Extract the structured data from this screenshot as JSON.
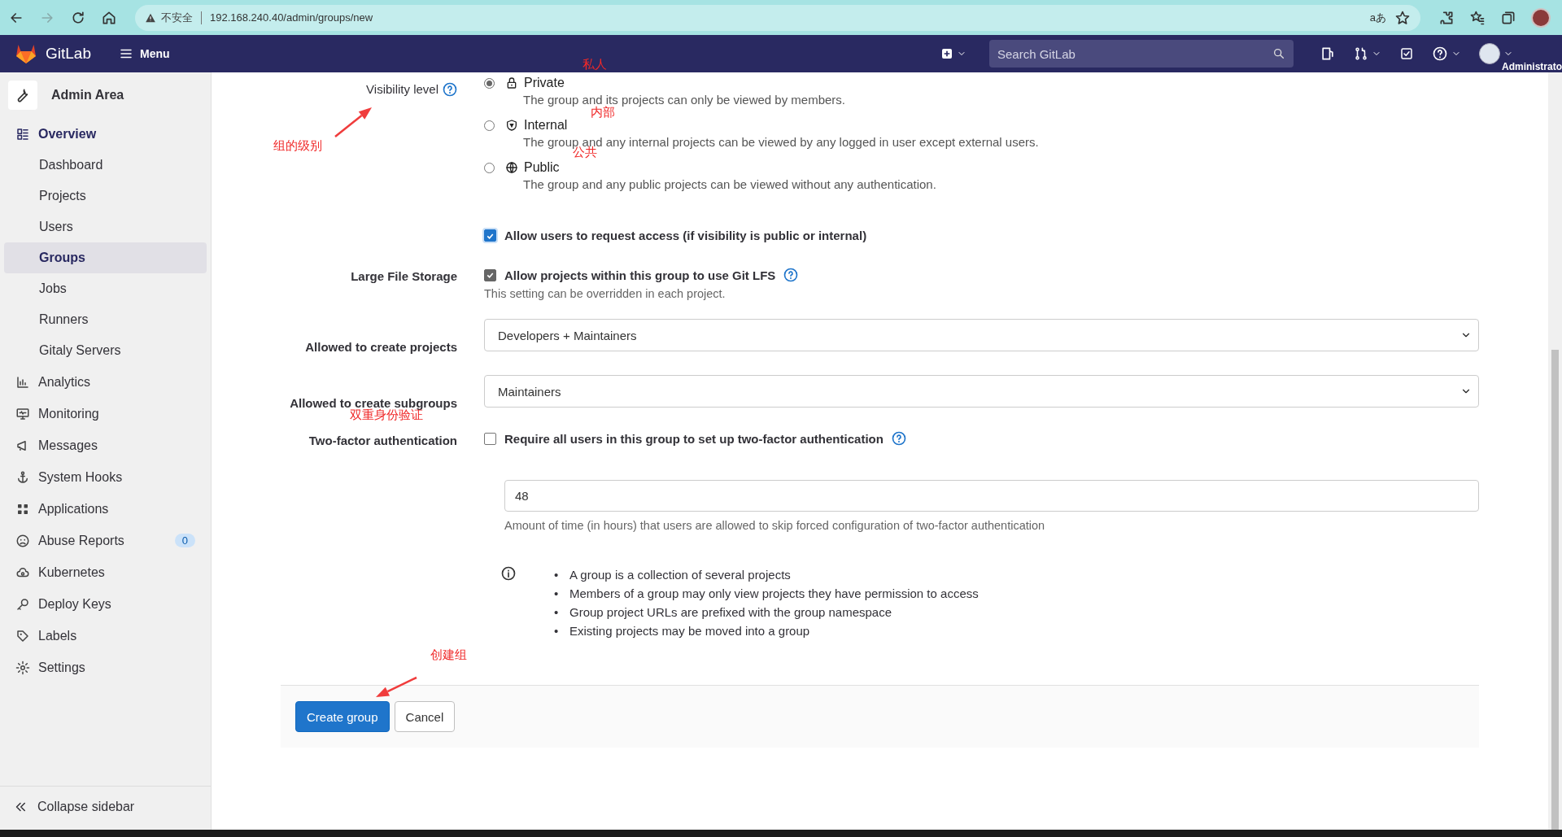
{
  "browser": {
    "security": "不安全",
    "url": "192.168.240.40/admin/groups/new",
    "read_aloud": "aあ"
  },
  "header": {
    "brand": "GitLab",
    "menu": "Menu",
    "search": {
      "placeholder": "Search GitLab"
    },
    "user": "Administrato"
  },
  "sidebar": {
    "title": "Admin Area",
    "items": [
      {
        "label": "Overview",
        "selected": true,
        "children": [
          {
            "label": "Dashboard",
            "selected": false
          },
          {
            "label": "Projects",
            "selected": false
          },
          {
            "label": "Users",
            "selected": false
          },
          {
            "label": "Groups",
            "selected": true
          },
          {
            "label": "Jobs",
            "selected": false
          },
          {
            "label": "Runners",
            "selected": false
          },
          {
            "label": "Gitaly Servers",
            "selected": false
          }
        ]
      },
      {
        "label": "Analytics",
        "selected": false
      },
      {
        "label": "Monitoring",
        "selected": false
      },
      {
        "label": "Messages",
        "selected": false
      },
      {
        "label": "System Hooks",
        "selected": false
      },
      {
        "label": "Applications",
        "selected": false
      },
      {
        "label": "Abuse Reports",
        "selected": false,
        "badge": "0"
      },
      {
        "label": "Kubernetes",
        "selected": false
      },
      {
        "label": "Deploy Keys",
        "selected": false
      },
      {
        "label": "Labels",
        "selected": false
      },
      {
        "label": "Settings",
        "selected": false
      }
    ],
    "collapse": "Collapse sidebar"
  },
  "form": {
    "visibility": {
      "label": "Visibility level",
      "options": [
        {
          "label": "Private",
          "description": "The group and its projects can only be viewed by members.",
          "selected": true
        },
        {
          "label": "Internal",
          "description": "The group and any internal projects can be viewed by any logged in user except external users.",
          "selected": false
        },
        {
          "label": "Public",
          "description": "The group and any public projects can be viewed without any authentication.",
          "selected": false
        }
      ]
    },
    "request_access": {
      "label": "Allow users to request access (if visibility is public or internal)",
      "checked": true,
      "focused": true
    },
    "lfs": {
      "label": "Large File Storage",
      "option": "Allow projects within this group to use Git LFS",
      "checked": true,
      "help": "This setting can be overridden in each project."
    },
    "create_projects": {
      "label": "Allowed to create projects",
      "value": "Developers + Maintainers"
    },
    "create_subgroups": {
      "label": "Allowed to create subgroups",
      "value": "Maintainers"
    },
    "two_factor": {
      "label": "Two-factor authentication",
      "option": "Require all users in this group to set up two-factor authentication",
      "checked": false,
      "grace_period": "48",
      "grace_help": "Amount of time (in hours) that users are allowed to skip forced configuration of two-factor authentication"
    },
    "info": [
      {
        "bullet": "•",
        "text": "A group is a collection of several projects"
      },
      {
        "bullet": "•",
        "text": "Members of a group may only view projects they have permission to access"
      },
      {
        "bullet": "•",
        "text": "Group project URLs are prefixed with the group namespace"
      },
      {
        "bullet": "•",
        "text": "Existing projects may be moved into a group"
      }
    ],
    "buttons": [
      {
        "label": "Create group",
        "kind": "primary"
      },
      {
        "label": "Cancel",
        "kind": "secondary"
      }
    ]
  },
  "annotations": [
    {
      "text": "私人",
      "arrow": false
    },
    {
      "text": "内部",
      "arrow": false
    },
    {
      "text": "公共",
      "arrow": false
    },
    {
      "text": "组的级别",
      "arrow": true
    },
    {
      "text": "双重身份验证",
      "arrow": false
    },
    {
      "text": "创建组",
      "arrow": true
    }
  ]
}
